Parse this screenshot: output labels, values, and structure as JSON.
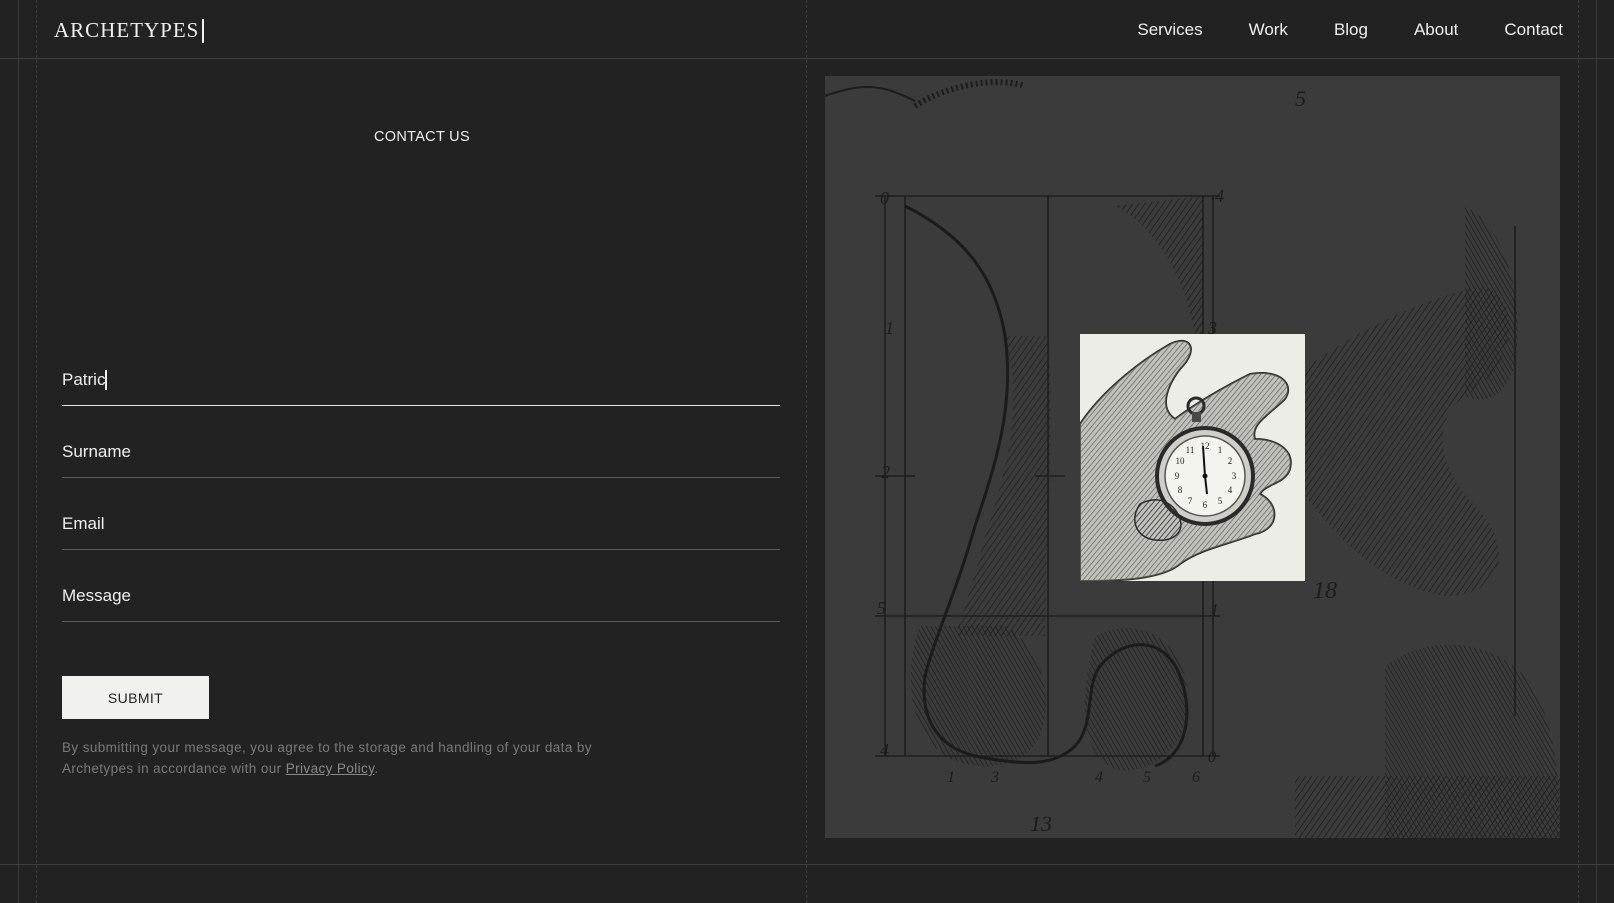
{
  "header": {
    "logo": "ARCHETYPES",
    "nav": [
      "Services",
      "Work",
      "Blog",
      "About",
      "Contact"
    ]
  },
  "contact": {
    "section_label": "CONTACT US",
    "fields": {
      "name_value": "Patric",
      "surname_placeholder": "Surname",
      "email_placeholder": "Email",
      "message_placeholder": "Message"
    },
    "submit_label": "SUBMIT",
    "disclaimer_text": "By submitting your message, you agree to the storage and handling of your data by Archetypes in accordance with our ",
    "privacy_link": "Privacy Policy",
    "disclaimer_end": "."
  },
  "artwork": {
    "numbers": [
      "5",
      "0",
      "4",
      "1",
      "3",
      "2",
      "5",
      "1",
      "4",
      "1",
      "3",
      "4",
      "5",
      "6",
      "0",
      "18",
      "13"
    ],
    "clock_numbers": [
      "12",
      "1",
      "2",
      "3",
      "4",
      "5",
      "6",
      "7",
      "8",
      "9",
      "10",
      "11"
    ]
  },
  "colors": {
    "background": "#222222",
    "text": "#f0f0ec",
    "art_background": "#3b3b3b",
    "photo_background": "#ecede6"
  }
}
